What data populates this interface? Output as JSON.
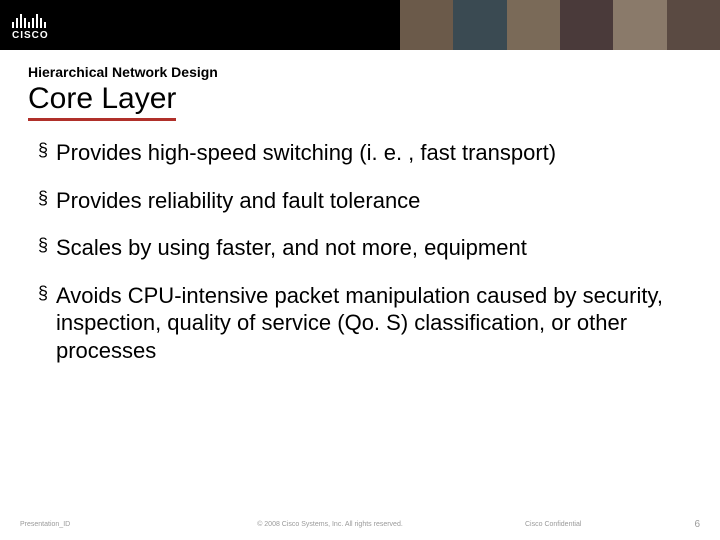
{
  "header": {
    "logo_text": "CISCO"
  },
  "slide": {
    "subtitle": "Hierarchical Network Design",
    "title": "Core Layer",
    "bullets": [
      "Provides high-speed switching (i. e. , fast transport)",
      "Provides reliability and fault tolerance",
      "Scales by using faster, and not more, equipment",
      "Avoids CPU-intensive packet manipulation caused by security, inspection, quality of service (Qo. S) classification, or other processes"
    ]
  },
  "footer": {
    "presentation_id": "Presentation_ID",
    "copyright": "© 2008 Cisco Systems, Inc. All rights reserved.",
    "confidential": "Cisco Confidential",
    "page": "6"
  }
}
